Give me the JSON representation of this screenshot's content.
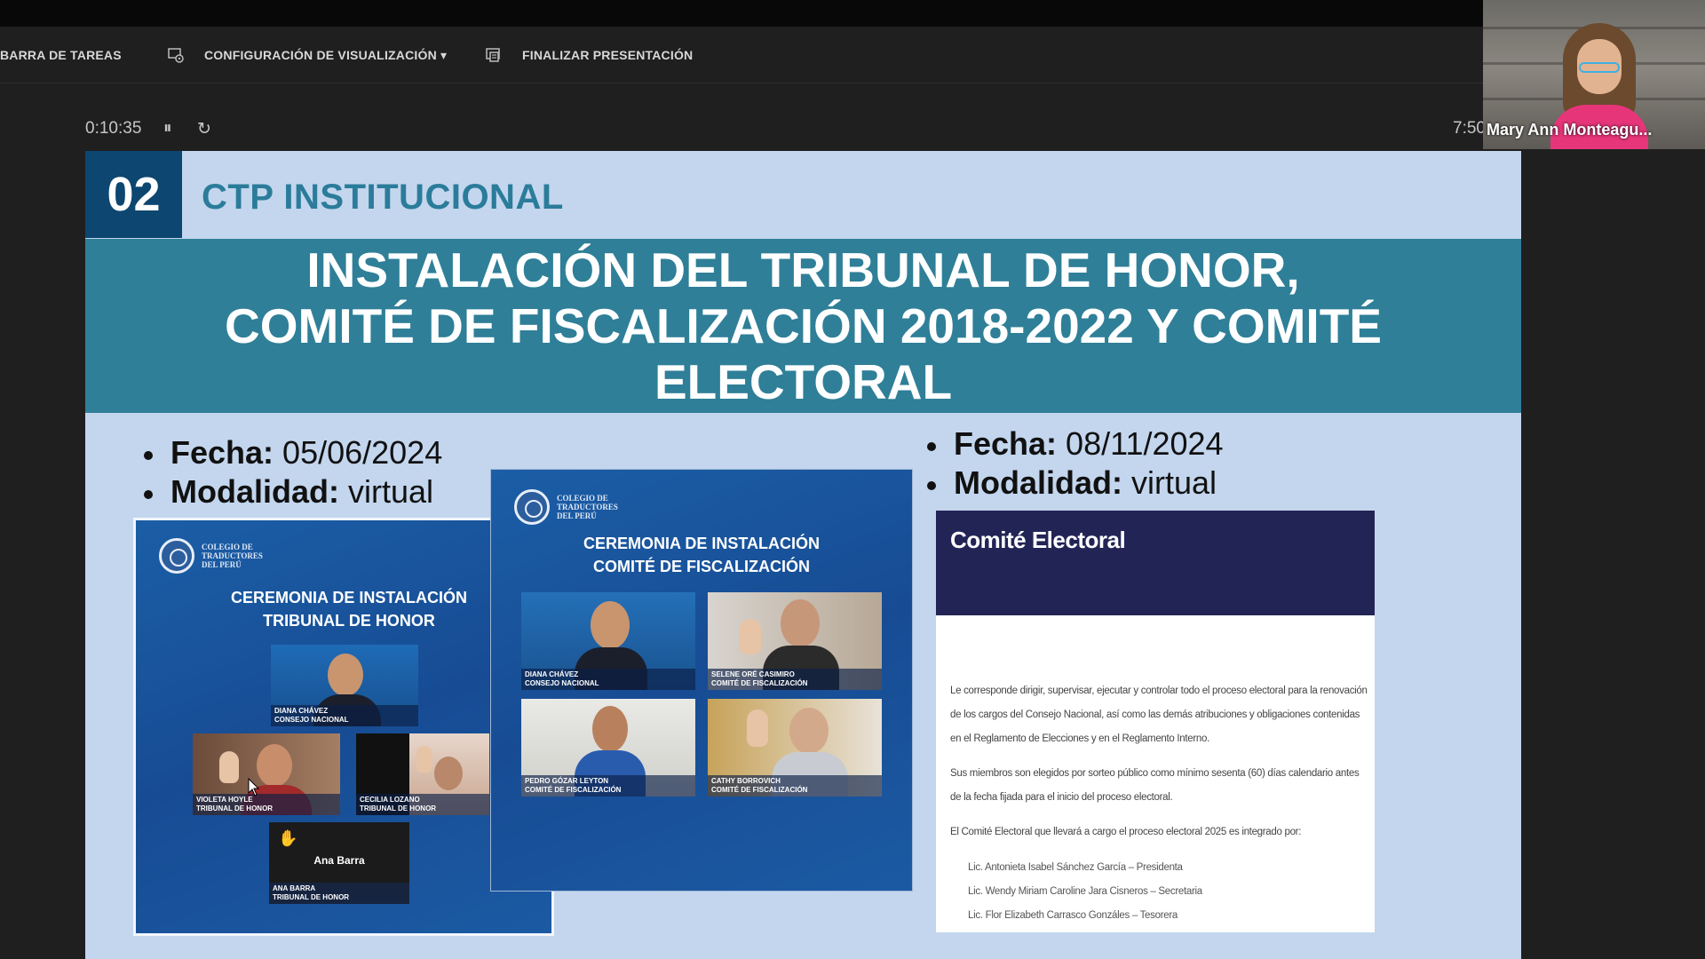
{
  "toolbar": {
    "taskbar_label": "BARRA DE TAREAS",
    "display_settings_label": "CONFIGURACIÓN DE VISUALIZACIÓN ▾",
    "end_presentation_label": "FINALIZAR PRESENTACIÓN"
  },
  "presenter": {
    "elapsed": "0:10:35",
    "clock": "7:50",
    "pause_glyph": "⏸",
    "restart_glyph": "↻"
  },
  "video": {
    "participant_name": "Mary Ann Monteagu..."
  },
  "slide": {
    "section_number": "02",
    "section_title": "CTP INSTITUCIONAL",
    "banner_lines": [
      "INSTALACIÓN DEL TRIBUNAL DE HONOR,",
      "COMITÉ DE FISCALIZACIÓN 2018-2022 Y COMITÉ",
      "ELECTORAL"
    ],
    "left_info": {
      "date_label": "Fecha:",
      "date_value": " 05/06/2024",
      "mode_label": "Modalidad:",
      "mode_value": " virtual"
    },
    "right_info": {
      "date_label": "Fecha:",
      "date_value": " 08/11/2024",
      "mode_label": "Modalidad:",
      "mode_value": " virtual"
    },
    "logo_text": "COLEGIO DE TRADUCTORES DEL PERÚ",
    "tribunal_card": {
      "title_1": "CEREMONIA DE INSTALACIÓN",
      "title_2": "TRIBUNAL DE HONOR",
      "tiles": [
        {
          "name": "DIANA CHÁVEZ",
          "role": "CONSEJO NACIONAL"
        },
        {
          "name": "VIOLETA HOYLE",
          "role": "TRIBUNAL DE HONOR"
        },
        {
          "name": "CECILIA LOZANO",
          "role": "TRIBUNAL DE HONOR"
        },
        {
          "name": "ANA BARRA",
          "role": "TRIBUNAL DE HONOR",
          "display": "Ana Barra"
        }
      ]
    },
    "fiscal_card": {
      "title_1": "CEREMONIA DE INSTALACIÓN",
      "title_2": "COMITÉ DE FISCALIZACIÓN",
      "tiles": [
        {
          "name": "DIANA CHÁVEZ",
          "role": "CONSEJO NACIONAL"
        },
        {
          "name": "SELENE ORÉ CASIMIRO",
          "role": "COMITÉ DE FISCALIZACIÓN"
        },
        {
          "name": "PEDRO GÓZAR LEYTON",
          "role": "COMITÉ DE FISCALIZACIÓN"
        },
        {
          "name": "CATHY BORROVICH",
          "role": "COMITÉ DE FISCALIZACIÓN"
        }
      ]
    },
    "electoral_doc": {
      "title": "Comité Electoral",
      "p1": "Le corresponde dirigir, supervisar, ejecutar y controlar todo el proceso electoral para la renovación de los cargos del Consejo Nacional, así como las demás atribuciones y obligaciones contenidas en el Reglamento de Elecciones y en el Reglamento Interno.",
      "p2": "Sus miembros son elegidos por sorteo público como mínimo sesenta (60) días calendario antes de la fecha fijada para el inicio del proceso electoral.",
      "p3": "El Comité Electoral que llevará a cargo el proceso electoral 2025 es integrado por:",
      "members": [
        "Lic. Antonieta Isabel Sánchez García – Presidenta",
        "Lic. Wendy Miriam Caroline Jara Cisneros – Secretaria",
        "Lic. Flor Elizabeth Carrasco Gonzáles – Tesorera"
      ]
    }
  }
}
